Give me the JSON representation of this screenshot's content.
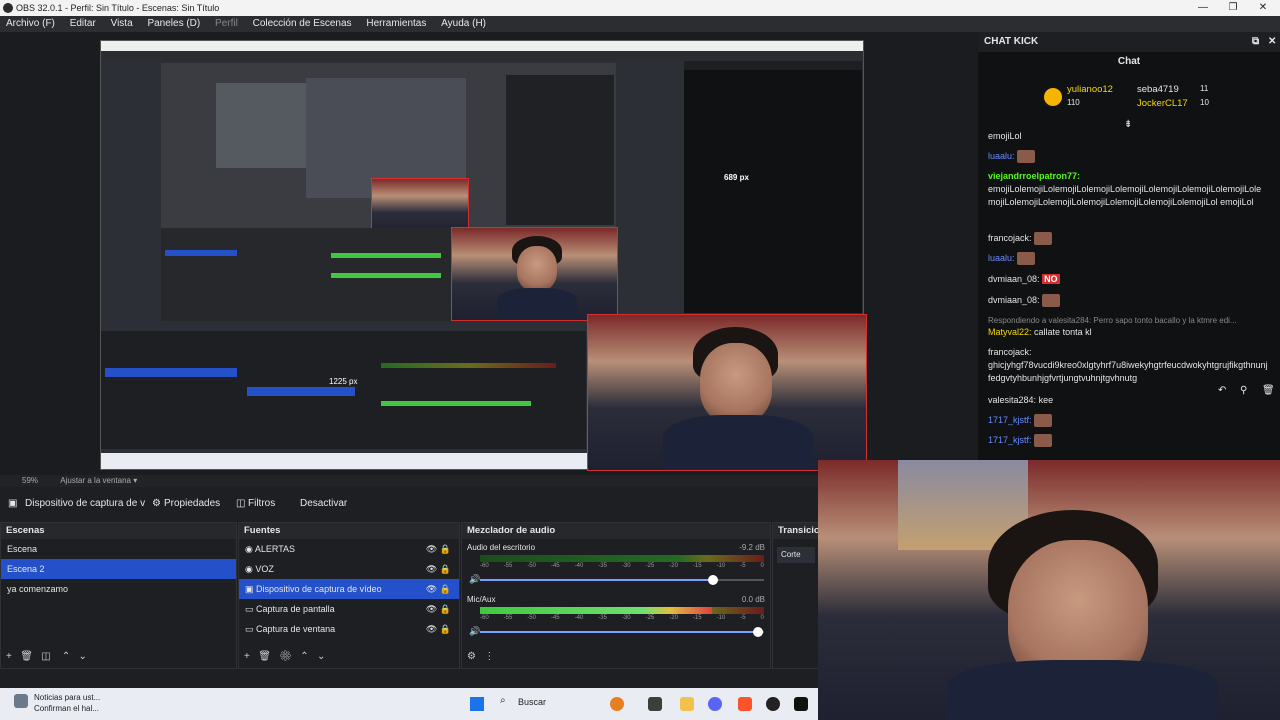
{
  "window": {
    "title": "OBS 32.0.1 - Perfil: Sin Título - Escenas: Sin Título",
    "controls": [
      "—",
      "❐",
      "✕"
    ]
  },
  "menu": [
    "Archivo (F)",
    "Editar",
    "Vista",
    "Paneles (D)",
    "Perfil",
    "Colección de Escenas",
    "Herramientas",
    "Ayuda (H)"
  ],
  "preview": {
    "zoom": "59%",
    "fit": "Ajustar a la ventana",
    "size_labels": [
      "689 px",
      "1225 px"
    ]
  },
  "source_toolbar": {
    "source": "Dispositivo de captura de v",
    "props": "Propiedades",
    "filters": "Filtros",
    "deactivate": "Desactivar"
  },
  "scenes": {
    "title": "Escenas",
    "items": [
      "Escena",
      "Escena 2",
      "ya comenzamo"
    ],
    "selected": 1
  },
  "sources": {
    "title": "Fuentes",
    "items": [
      "ALERTAS",
      "VOZ",
      "Dispositivo de captura de vídeo",
      "Captura de pantalla",
      "Captura de ventana"
    ],
    "selected": 2
  },
  "mixer": {
    "title": "Mezclador de audio",
    "channels": [
      {
        "name": "Audio del escritorio",
        "db": "-9.2 dB",
        "level": 0.0,
        "volume": 0.82
      },
      {
        "name": "Mic/Aux",
        "db": "0.0 dB",
        "level": 0.96,
        "volume": 0.98
      }
    ],
    "scale": [
      "-60",
      "-55",
      "-50",
      "-45",
      "-40",
      "-35",
      "-30",
      "-25",
      "-20",
      "-15",
      "-10",
      "-5",
      "0"
    ]
  },
  "transitions": {
    "title": "Transicio",
    "value": "Corte"
  },
  "chat": {
    "panel_title": "CHAT KICK",
    "title": "Chat",
    "top": [
      {
        "name": "yulianoo12",
        "count": "110"
      },
      {
        "name": "seba4719",
        "count": "11"
      },
      {
        "name": "JockerCL17",
        "count": "10"
      }
    ],
    "messages": [
      {
        "user": "",
        "text": "emojiLol"
      },
      {
        "user": "luaalu:",
        "text": ""
      },
      {
        "user": "viejandrroelpatron77:",
        "text": "emojiLolemojiLolemojiLolemojiLolemojiLolemojiLolemojiLolemojiLolemojiLolemojiLolemojiLolemojiLolemojiLolemojiLolemojiLol emojiLol"
      },
      {
        "user": "francojack:",
        "text": ""
      },
      {
        "user": "luaalu:",
        "text": ""
      },
      {
        "user": "dvmiaan_08:",
        "text": "NO"
      },
      {
        "user": "dvmiaan_08:",
        "text": ""
      },
      {
        "user": "",
        "text": "Respondiendo a valesita284: Perro sapo tonto bacallo y la ktmre edi..."
      },
      {
        "user": "Matyval22:",
        "text": "callate tonta kl"
      },
      {
        "user": "francojack:",
        "text": "ghicjyhgf78vucdi9kreo0xlgtyhrf7u8iwekyhgtrfeucdwokyhtgrujfikgthnunjfedgvtyhbunhjgfvrtjungtvuhnjtgvhnutg"
      },
      {
        "user": "valesita284:",
        "text": "kee"
      },
      {
        "user": "1717_kjstf:",
        "text": ""
      },
      {
        "user": "1717_kjstf:",
        "text": ""
      }
    ]
  },
  "taskbar": {
    "notification": "Noticias para ust...",
    "notification_sub": "Confirman el hal...",
    "search": "Buscar"
  },
  "colors": {
    "accent": "#2451c9",
    "kick_green": "#53fc18",
    "selection_red": "#d32f2f"
  }
}
